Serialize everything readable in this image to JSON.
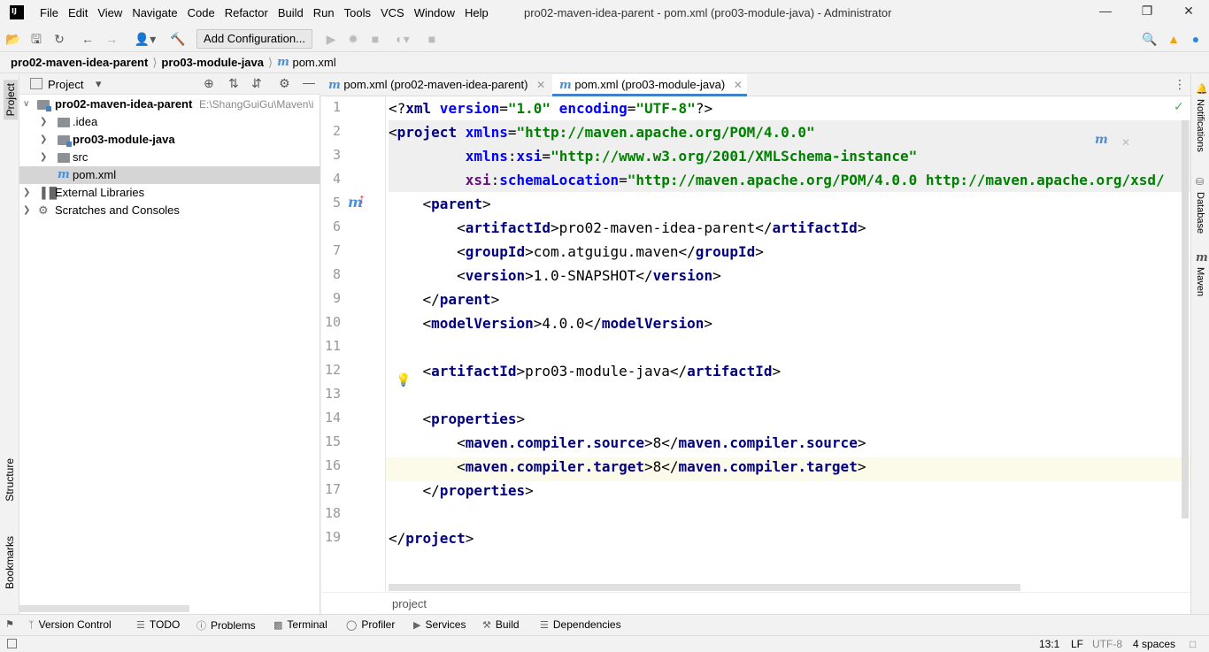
{
  "app": {
    "logo_text": "IJ",
    "window_title": "pro02-maven-idea-parent - pom.xml (pro03-module-java) - Administrator",
    "menu": [
      "File",
      "Edit",
      "View",
      "Navigate",
      "Code",
      "Refactor",
      "Build",
      "Run",
      "Tools",
      "VCS",
      "Window",
      "Help"
    ]
  },
  "toolbar": {
    "run_config_label": "Add Configuration..."
  },
  "breadcrumb": [
    "pro02-maven-idea-parent",
    "pro03-module-java",
    "pom.xml"
  ],
  "left_stripe": {
    "project_label": "Project",
    "structure_label": "Structure",
    "bookmarks_label": "Bookmarks"
  },
  "project_panel": {
    "title": "Project",
    "tree": [
      {
        "label": "pro02-maven-idea-parent",
        "path": "E:\\ShangGuiGu\\Maven\\i",
        "bold": true
      },
      {
        "label": ".idea"
      },
      {
        "label": "pro03-module-java",
        "bold": true
      },
      {
        "label": "src"
      },
      {
        "label": "pom.xml",
        "selected": true
      },
      {
        "label": "External Libraries"
      },
      {
        "label": "Scratches and Consoles"
      }
    ]
  },
  "editor": {
    "tabs": [
      {
        "label": "pom.xml (pro02-maven-idea-parent)"
      },
      {
        "label": "pom.xml (pro03-module-java)",
        "active": true
      }
    ],
    "line_numbers": [
      "1",
      "2",
      "3",
      "4",
      "5",
      "6",
      "7",
      "8",
      "9",
      "10",
      "11",
      "12",
      "13",
      "14",
      "15",
      "16",
      "17",
      "18",
      "19"
    ],
    "code": {
      "l1_decl_open": "<?",
      "l1_xml": "xml",
      "l1_ver_attr": " version",
      "l1_eq1": "=",
      "l1_ver_val": "\"1.0\"",
      "l1_enc_attr": " encoding",
      "l1_eq2": "=",
      "l1_enc_val": "\"UTF-8\"",
      "l1_decl_close": "?>",
      "l2_open": "<",
      "l2_tag": "project",
      "l2_attr": " xmlns",
      "l2_eq": "=",
      "l2_val": "\"http://maven.apache.org/POM/4.0.0\"",
      "l3_indent": "         ",
      "l3_ns": "xmlns",
      "l3_colon": ":",
      "l3_attr": "xsi",
      "l3_eq": "=",
      "l3_val": "\"http://www.w3.org/2001/XMLSchema-instance\"",
      "l4_indent": "         ",
      "l4_ns": "xsi",
      "l4_colon": ":",
      "l4_attr": "schemaLocation",
      "l4_eq": "=",
      "l4_val": "\"http://maven.apache.org/POM/4.0.0 http://maven.apache.org/xsd/",
      "l5_open": "    <",
      "l5_tag": "parent",
      "l5_close": ">",
      "l6_open": "        <",
      "l6_tag": "artifactId",
      "l6_mid": ">pro02-maven-idea-parent</",
      "l6_tag2": "artifactId",
      "l6_close": ">",
      "l7_open": "        <",
      "l7_tag": "groupId",
      "l7_mid": ">com.atguigu.maven</",
      "l7_tag2": "groupId",
      "l7_close": ">",
      "l8_open": "        <",
      "l8_tag": "version",
      "l8_mid": ">1.0-SNAPSHOT</",
      "l8_tag2": "version",
      "l8_close": ">",
      "l9_open": "    </",
      "l9_tag": "parent",
      "l9_close": ">",
      "l10_open": "    <",
      "l10_tag": "modelVersion",
      "l10_mid": ">4.0.0</",
      "l10_tag2": "modelVersion",
      "l10_close": ">",
      "l12_open": "    <",
      "l12_tag": "artifactId",
      "l12_mid": ">pro03-module-java</",
      "l12_tag2": "artifactId",
      "l12_close": ">",
      "l14_open": "    <",
      "l14_tag": "properties",
      "l14_close": ">",
      "l15_open": "        <",
      "l15_tag": "maven.compiler.source",
      "l15_mid": ">8</",
      "l15_tag2": "maven.compiler.source",
      "l15_close": ">",
      "l16_open": "        <",
      "l16_tag": "maven.compiler.target",
      "l16_mid": ">8</",
      "l16_tag2": "maven.compiler.target",
      "l16_close": ">",
      "l17_open": "    </",
      "l17_tag": "properties",
      "l17_close": ">",
      "l19_open": "</",
      "l19_tag": "project",
      "l19_close": ">"
    },
    "footer_breadcrumb": "project",
    "maven_reload_icon": "m"
  },
  "right_stripe": {
    "notifications_label": "Notifications",
    "database_label": "Database",
    "maven_label": "Maven",
    "maven_glyph": "m"
  },
  "bottom_tools": [
    "Version Control",
    "TODO",
    "Problems",
    "Terminal",
    "Profiler",
    "Services",
    "Build",
    "Dependencies"
  ],
  "status": {
    "position": "13:1",
    "line_sep": "LF",
    "encoding": "UTF-8",
    "indent": "4 spaces"
  },
  "colors": {
    "accent": "#4083c9",
    "maven_blue": "#4a90d9",
    "tag": "#000080",
    "string": "#008000"
  }
}
